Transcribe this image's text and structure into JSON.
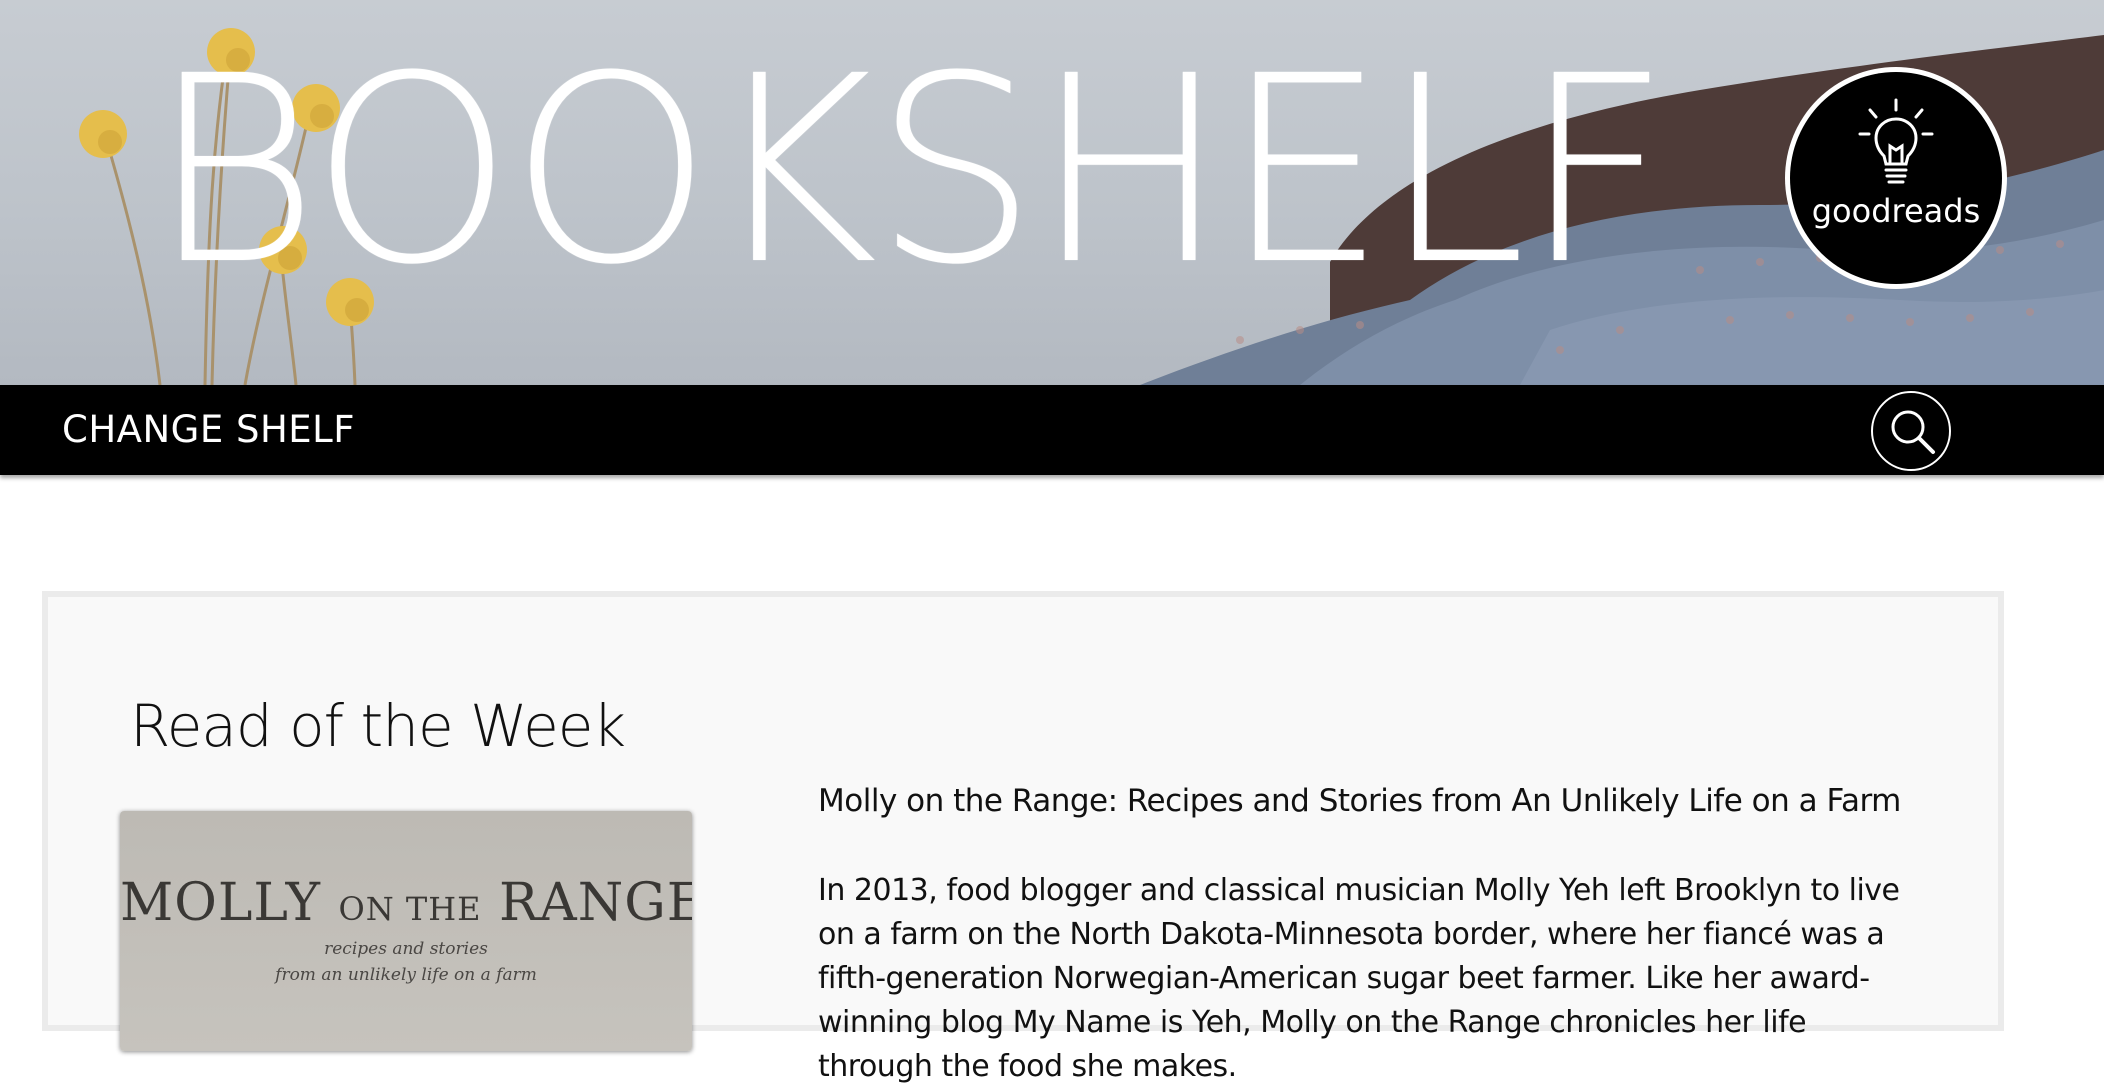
{
  "banner": {
    "title": "BOOKSHELF",
    "badge_label": "goodreads",
    "badge_icon": "lightbulb-icon"
  },
  "navbar": {
    "change_shelf_label": "CHANGE SHELF",
    "search_icon": "search-icon"
  },
  "featured": {
    "heading": "Read of the Week",
    "cover": {
      "title_word1": "MOLLY",
      "title_small": "ON THE",
      "title_word2": "RANGE",
      "subtitle_line1": "recipes and stories",
      "subtitle_line2": "from an unlikely life on a farm"
    },
    "book_title": "Molly on the Range: Recipes and Stories from An Unlikely Life on a Farm",
    "description": "In 2013, food blogger and classical musician Molly Yeh left Brooklyn to live on a farm on the North Dakota-Minnesota border, where her fiancé was a fifth-generation Norwegian-American sugar beet farmer. Like her award-winning blog My Name is Yeh, Molly on the Range chronicles her life through the food she makes."
  },
  "colors": {
    "navbar_bg": "#000000",
    "card_bg": "#f9f9f9",
    "card_border": "#ebebeb",
    "text": "#111111"
  }
}
